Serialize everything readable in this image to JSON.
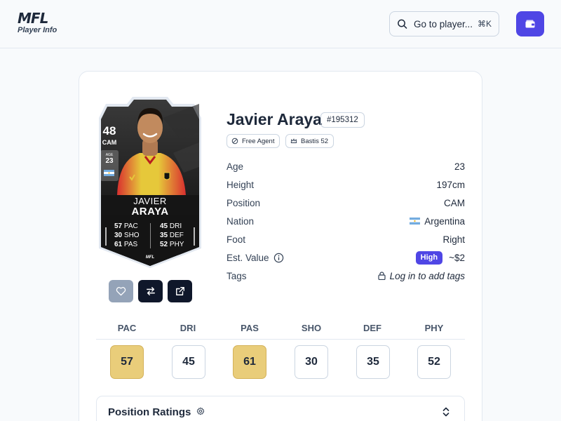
{
  "header": {
    "logo_mark": "MFL",
    "logo_sub": "Player Info",
    "search_placeholder": "Go to player...",
    "search_shortcut": "⌘K",
    "wallet_icon": "wallet-icon"
  },
  "card": {
    "overall": "48",
    "position": "CAM",
    "age_label": "AGE",
    "age": "23",
    "first_name": "JAVIER",
    "last_name": "ARAYA",
    "stats_left": [
      {
        "value": "57",
        "label": "PAC"
      },
      {
        "value": "30",
        "label": "SHO"
      },
      {
        "value": "61",
        "label": "PAS"
      }
    ],
    "stats_right": [
      {
        "value": "45",
        "label": "DRI"
      },
      {
        "value": "35",
        "label": "DEF"
      },
      {
        "value": "52",
        "label": "PHY"
      }
    ],
    "brand": "MFL"
  },
  "actions": {
    "favorite_icon": "heart-icon",
    "swap_icon": "swap-icon",
    "open_icon": "external-link-icon"
  },
  "player": {
    "name": "Javier Araya",
    "id": "#195312",
    "chips": [
      "Free Agent",
      "Bastis 52"
    ],
    "rows": [
      {
        "label": "Age",
        "value": "23"
      },
      {
        "label": "Height",
        "value": "197cm"
      },
      {
        "label": "Position",
        "value": "CAM"
      },
      {
        "label": "Nation",
        "value": "Argentina"
      },
      {
        "label": "Foot",
        "value": "Right"
      },
      {
        "label": "Est. Value",
        "badge": "High",
        "value": "~$2"
      },
      {
        "label": "Tags",
        "value": "Log in to add tags"
      }
    ]
  },
  "stats_table": {
    "headers": [
      "PAC",
      "DRI",
      "PAS",
      "SHO",
      "DEF",
      "PHY"
    ],
    "values": [
      "57",
      "45",
      "61",
      "30",
      "35",
      "52"
    ],
    "highlighted": [
      true,
      false,
      true,
      false,
      false,
      false
    ]
  },
  "position_ratings": {
    "title": "Position Ratings"
  },
  "colors": {
    "accent": "#4f46e5",
    "highlight": "#e9cd7a",
    "dark": "#0f172a"
  }
}
